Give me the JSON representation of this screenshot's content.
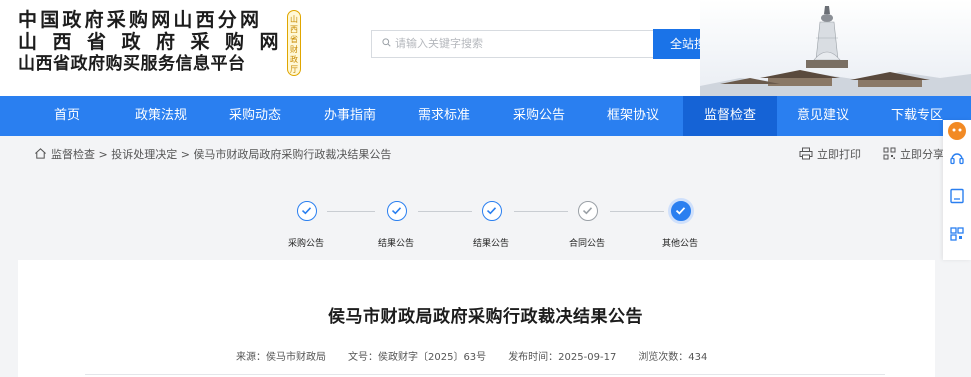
{
  "header": {
    "title_line1": "中国政府采购网山西分网",
    "title_line2": "山西省政府采购网",
    "title_line3": "山西省政府购买服务信息平台",
    "seal_text": "山西省财政厅",
    "search": {
      "placeholder": "请输入关键字搜索",
      "button_label": "全站搜索"
    }
  },
  "nav": {
    "items": [
      {
        "label": "首页"
      },
      {
        "label": "政策法规"
      },
      {
        "label": "采购动态"
      },
      {
        "label": "办事指南"
      },
      {
        "label": "需求标准"
      },
      {
        "label": "采购公告"
      },
      {
        "label": "框架协议"
      },
      {
        "label": "监督检查",
        "active": true
      },
      {
        "label": "意见建议"
      },
      {
        "label": "下载专区"
      }
    ]
  },
  "breadcrumb": {
    "items": [
      "监督检查",
      "投诉处理决定",
      "侯马市财政局政府采购行政裁决结果公告"
    ],
    "separator": ">"
  },
  "tools": {
    "print_label": "立即打印",
    "share_label": "立即分享"
  },
  "steps": [
    {
      "label": "采购公告",
      "state": "done"
    },
    {
      "label": "结果公告",
      "state": "done"
    },
    {
      "label": "结果公告",
      "state": "done"
    },
    {
      "label": "合同公告",
      "state": "pending"
    },
    {
      "label": "其他公告",
      "state": "current"
    }
  ],
  "article": {
    "title": "侯马市财政局政府采购行政裁决结果公告",
    "source_label": "来源：侯马市财政局",
    "doc_no_label": "文号：侯政财字〔2025〕63号",
    "publish_label": "发布时间：2025-09-17",
    "views_label": "浏览次数：434"
  },
  "colors": {
    "primary": "#2a7ff0",
    "nav_active": "#1563d6",
    "page_bg": "#f3f4f6"
  }
}
